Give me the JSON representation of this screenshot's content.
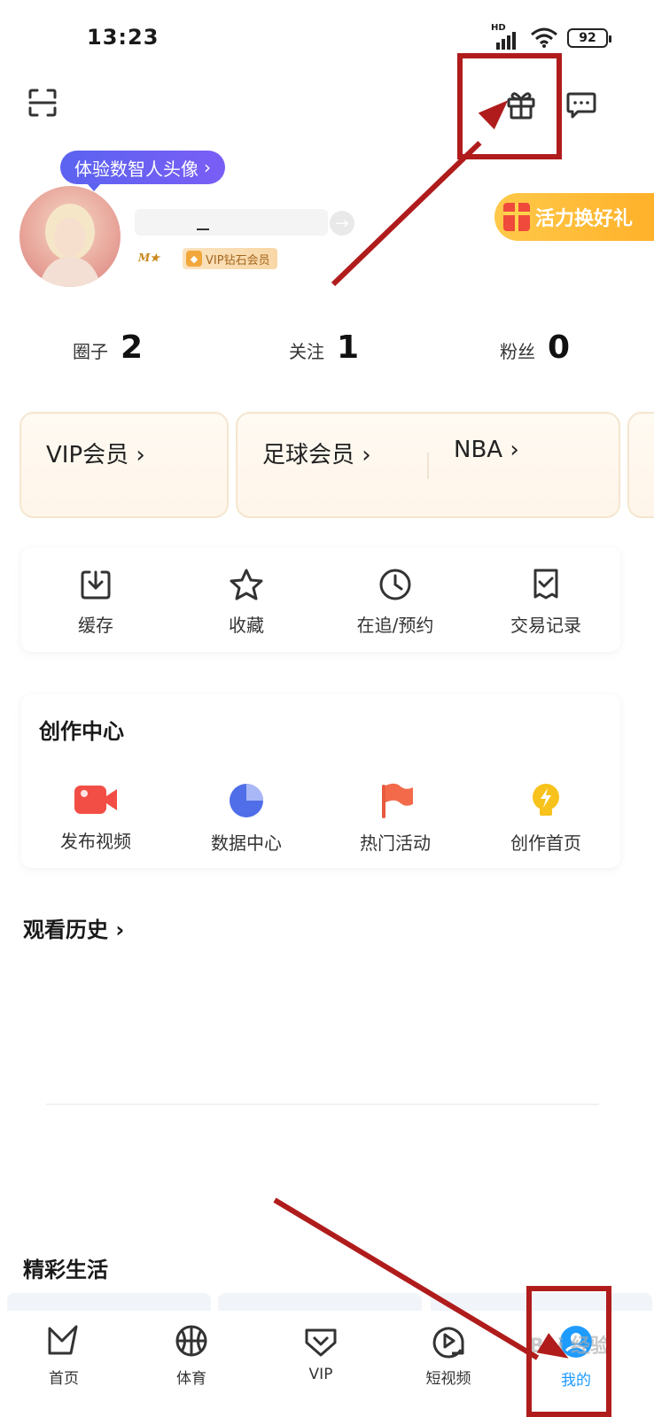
{
  "status_bar": {
    "time": "13:23",
    "network": "HD",
    "battery": "92"
  },
  "header": {
    "scan_icon": "scan-icon",
    "gift_icon": "gift-icon",
    "message_icon": "message-icon"
  },
  "profile": {
    "digital_avatar_bubble": "体验数智人头像",
    "vip_badge": "VIP钻石会员",
    "promo_label": "活力换好礼"
  },
  "stats": [
    {
      "label": "圈子",
      "value": "2"
    },
    {
      "label": "关注",
      "value": "1"
    },
    {
      "label": "粉丝",
      "value": "0"
    }
  ],
  "member_cards": {
    "vip": "VIP会员",
    "football": "足球会员",
    "nba": "NBA"
  },
  "quick_actions": [
    {
      "label": "缓存",
      "icon": "download-icon"
    },
    {
      "label": "收藏",
      "icon": "star-icon"
    },
    {
      "label": "在追/预约",
      "icon": "clock-icon"
    },
    {
      "label": "交易记录",
      "icon": "receipt-icon"
    }
  ],
  "creation_center": {
    "title": "创作中心",
    "items": [
      {
        "label": "发布视频",
        "icon": "video-camera-icon"
      },
      {
        "label": "数据中心",
        "icon": "pie-chart-icon"
      },
      {
        "label": "热门活动",
        "icon": "flag-icon"
      },
      {
        "label": "创作首页",
        "icon": "lightbulb-icon"
      }
    ]
  },
  "history": {
    "title": "观看历史"
  },
  "life": {
    "title": "精彩生活"
  },
  "tabbar": [
    {
      "label": "首页",
      "icon": "home-icon"
    },
    {
      "label": "体育",
      "icon": "basketball-icon"
    },
    {
      "label": "VIP",
      "icon": "vip-icon"
    },
    {
      "label": "短视频",
      "icon": "play-icon"
    },
    {
      "label": "我的",
      "icon": "profile-icon",
      "active": true
    }
  ],
  "colors": {
    "accent_blue": "#1e9bff",
    "annotation_red": "#b01c1c",
    "bubble_purple": "#5b63f0",
    "promo_orange": "#ffb12a"
  },
  "watermark": "Bai 经验"
}
